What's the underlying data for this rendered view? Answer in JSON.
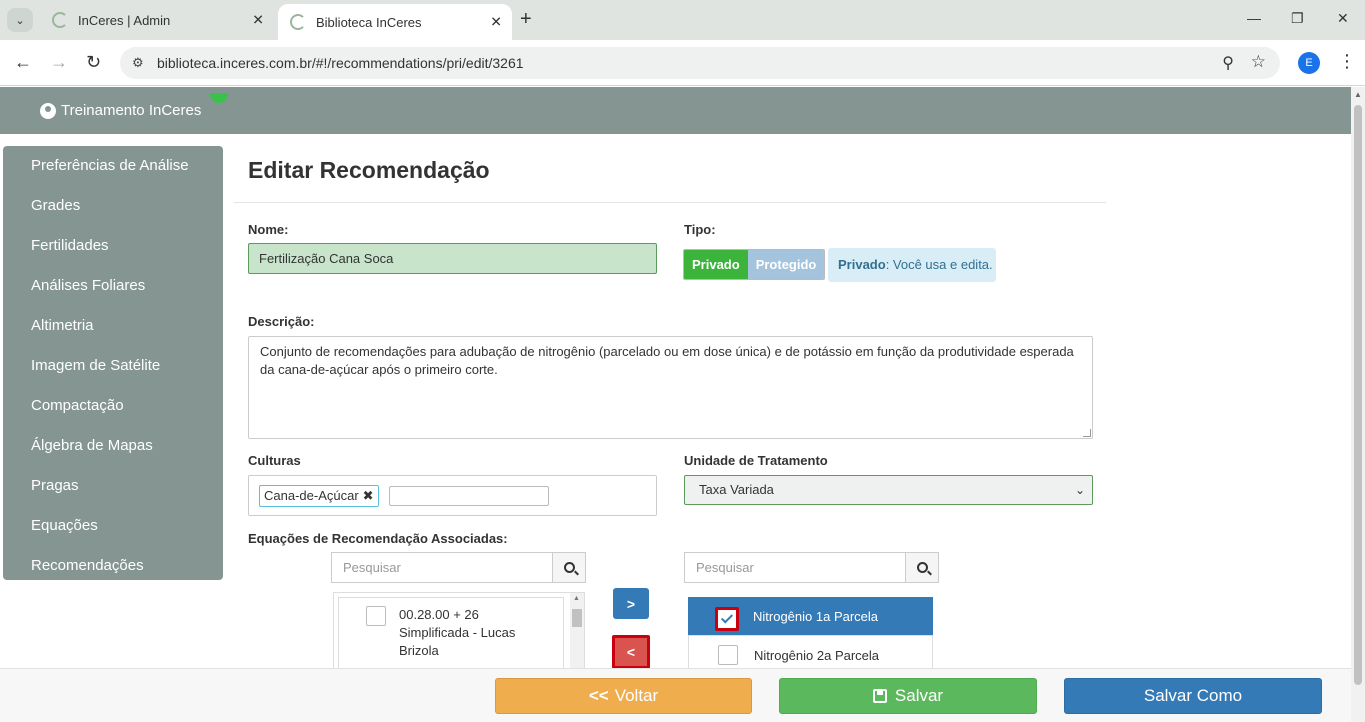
{
  "browser": {
    "tabs": [
      {
        "title": "InCeres | Admin"
      },
      {
        "title": "Biblioteca InCeres"
      }
    ],
    "close_glyph": "✕",
    "new_tab_glyph": "+",
    "url": "biblioteca.inceres.com.br/#!/recommendations/pri/edit/3261",
    "profile_initial": "E"
  },
  "header": {
    "user": "Treinamento InCeres"
  },
  "sidebar": {
    "items": [
      {
        "label": "Preferências de Análise"
      },
      {
        "label": "Grades"
      },
      {
        "label": "Fertilidades"
      },
      {
        "label": "Análises Foliares"
      },
      {
        "label": "Altimetria"
      },
      {
        "label": "Imagem de Satélite"
      },
      {
        "label": "Compactação"
      },
      {
        "label": "Álgebra de Mapas"
      },
      {
        "label": "Pragas"
      },
      {
        "label": "Equações"
      },
      {
        "label": "Recomendações"
      }
    ]
  },
  "form": {
    "title": "Editar Recomendação",
    "nome_label": "Nome:",
    "nome_value": "Fertilização Cana Soca",
    "tipo_label": "Tipo:",
    "tipo_options": [
      "Privado",
      "Protegido"
    ],
    "tipo_info_strong": "Privado",
    "tipo_info_rest": ": Você usa e edita.",
    "descricao_label": "Descrição:",
    "descricao_value": "Conjunto de recomendações para adubação de nitrogênio (parcelado ou em dose única) e de potássio em função da produtividade esperada da cana-de-açúcar após o primeiro corte.",
    "culturas_label": "Culturas",
    "culturas_tags": [
      "Cana-de-Açúcar"
    ],
    "tag_remove_glyph": "✖",
    "unidade_label": "Unidade de Tratamento",
    "unidade_value": "Taxa Variada",
    "equacoes_label": "Equações de Recomendação Associadas:",
    "search_placeholder": "Pesquisar",
    "available": [
      {
        "label": "00.28.00 + 26 Simplificada - Lucas Brizola"
      }
    ],
    "associated": [
      {
        "label": "Nitrogênio 1a Parcela",
        "selected": true
      },
      {
        "label": "Nitrogênio 2a Parcela",
        "selected": false
      }
    ]
  },
  "footer": {
    "voltar": "Voltar",
    "salvar": "Salvar",
    "salvar_como": "Salvar Como"
  },
  "colors": {
    "header_bg": "#859591",
    "primary": "#337ab7",
    "success": "#5cb85c",
    "warning": "#f0ad4e",
    "danger": "#d9534f"
  }
}
